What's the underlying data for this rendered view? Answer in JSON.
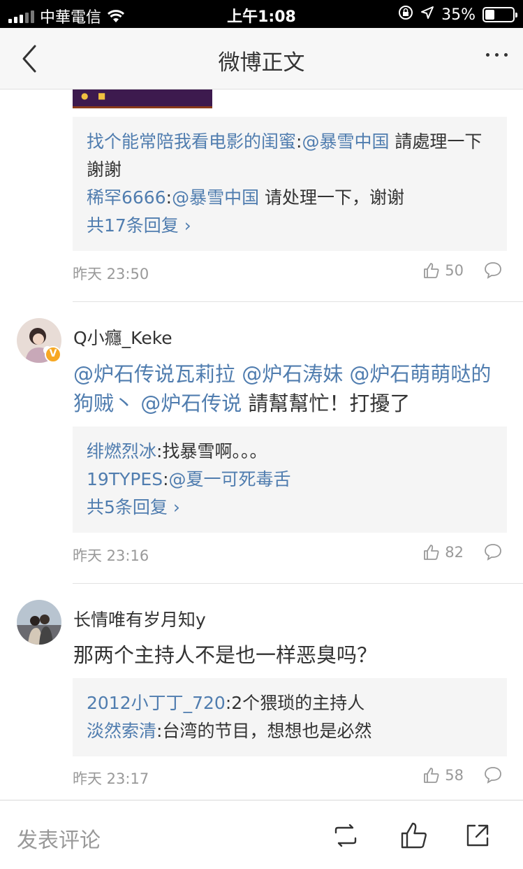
{
  "status_bar": {
    "carrier": "中華電信",
    "time": "上午1:08",
    "battery_percent": "35%",
    "battery_level": 0.35
  },
  "nav": {
    "title": "微博正文"
  },
  "comments": [
    {
      "replies": [
        {
          "user": "找个能常陪我看电影的闺蜜",
          "sep": ":",
          "mention": "@暴雪中国",
          "text": " 請處理一下謝謝"
        },
        {
          "user": "稀罕6666",
          "sep": ":",
          "mention": "@暴雪中国",
          "text": " 请处理一下，谢谢"
        }
      ],
      "more_replies": "共17条回复",
      "time": "昨天 23:50",
      "likes": "50"
    },
    {
      "username": "Q小癮_Keke",
      "body_mentions": "@炉石传说瓦莉拉 @炉石涛妹 @炉石萌萌哒的狗贼丶 @炉石传说",
      "body_text": " 請幫幫忙！打擾了",
      "replies": [
        {
          "user": "绯燃烈冰",
          "sep": ":",
          "text": "找暴雪啊。。。"
        },
        {
          "user": "19TYPES",
          "sep": ":",
          "mention": "@夏一可死毒舌",
          "text": ""
        }
      ],
      "more_replies": "共5条回复",
      "time": "昨天 23:16",
      "likes": "82"
    },
    {
      "username": "长情唯有岁月知y",
      "body_text": "那两个主持人不是也一样恶臭吗？",
      "replies": [
        {
          "user": "2012小丁丁_720",
          "sep": ":",
          "text": "2个猥琐的主持人"
        },
        {
          "user": "淡然索清",
          "sep": ":",
          "text": "台湾的节目，想想也是必然"
        }
      ],
      "time": "昨天 23:17",
      "likes": "58"
    }
  ],
  "bottom_bar": {
    "input_placeholder": "发表评论"
  },
  "colors": {
    "link": "#507daf",
    "reply_bg": "#f5f5f5",
    "verified": "#f7a823"
  }
}
